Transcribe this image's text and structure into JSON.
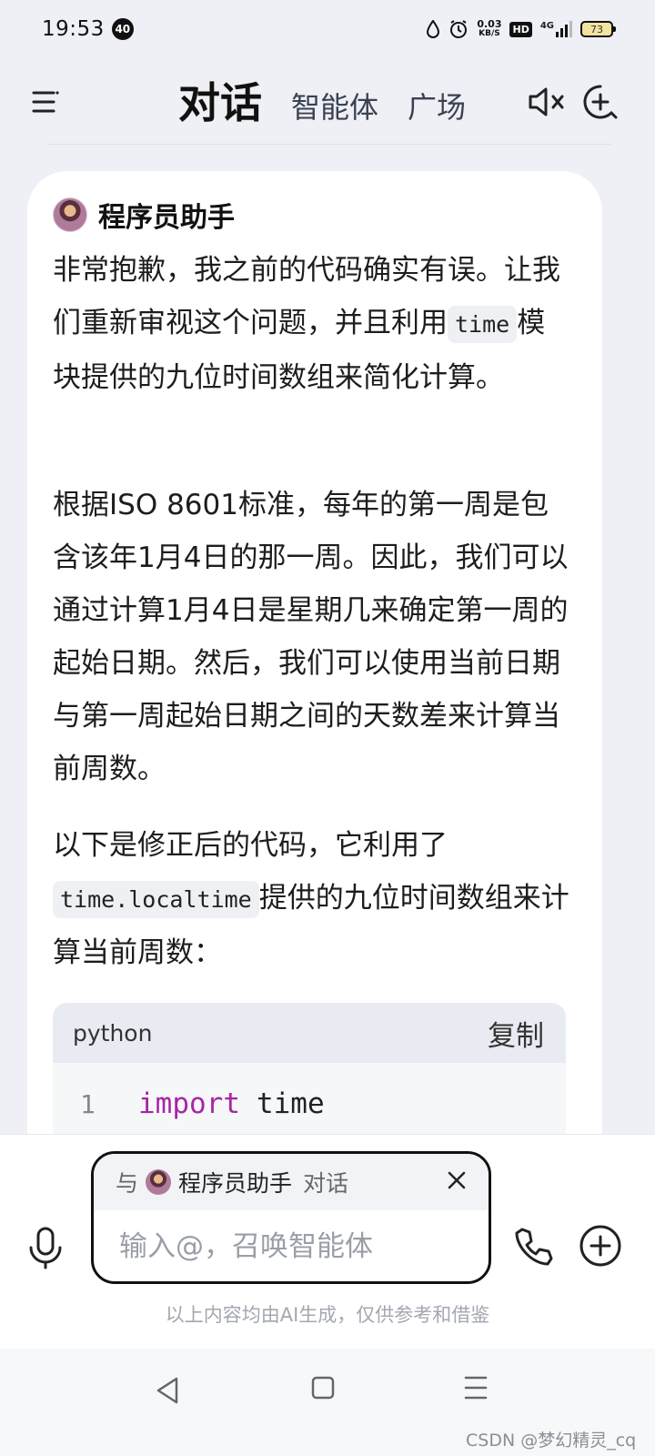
{
  "status_bar": {
    "time": "19:53",
    "notification_count": "40",
    "net_speed_value": "0.03",
    "net_speed_unit": "KB/S",
    "hd_label": "HD",
    "signal_label": "4G",
    "battery_level": "73"
  },
  "nav": {
    "tabs": [
      {
        "label": "对话",
        "active": true
      },
      {
        "label": "智能体",
        "active": false
      },
      {
        "label": "广场",
        "active": false
      }
    ]
  },
  "message": {
    "sender": "程序员助手",
    "p1_before": "非常抱歉，我之前的代码确实有误。让我们重新审视这个问题，并且利用",
    "p1_code": "time",
    "p1_after": "模块提供的九位时间数组来简化计算。",
    "p2": "根据ISO 8601标准，每年的第一周是包含该年1月4日的那一周。因此，我们可以通过计算1月4日是星期几来确定第一周的起始日期。然后，我们可以使用当前日期与第一周起始日期之间的天数差来计算当前周数。",
    "p3_before": "以下是修正后的代码，它利用了",
    "p3_code": "time.localtime",
    "p3_after": "提供的九位时间数组来计算当前周数：",
    "code_block": {
      "language": "python",
      "copy_label": "复制",
      "lines": [
        {
          "number": "1",
          "keyword": "import",
          "rest": "time"
        }
      ]
    }
  },
  "input": {
    "context_with": "与",
    "context_name": "程序员助手",
    "context_chat": "对话",
    "placeholder": "输入@，召唤智能体",
    "value": ""
  },
  "disclaimer": "以上内容均由AI生成，仅供参考和借鉴",
  "watermark": "CSDN @梦幻精灵_cq",
  "icons": {
    "menu": "menu-icon",
    "mute": "speaker-mute-icon",
    "new_chat": "new-chat-icon",
    "mic": "microphone-icon",
    "phone": "phone-icon",
    "plus": "plus-icon",
    "close": "close-icon"
  }
}
